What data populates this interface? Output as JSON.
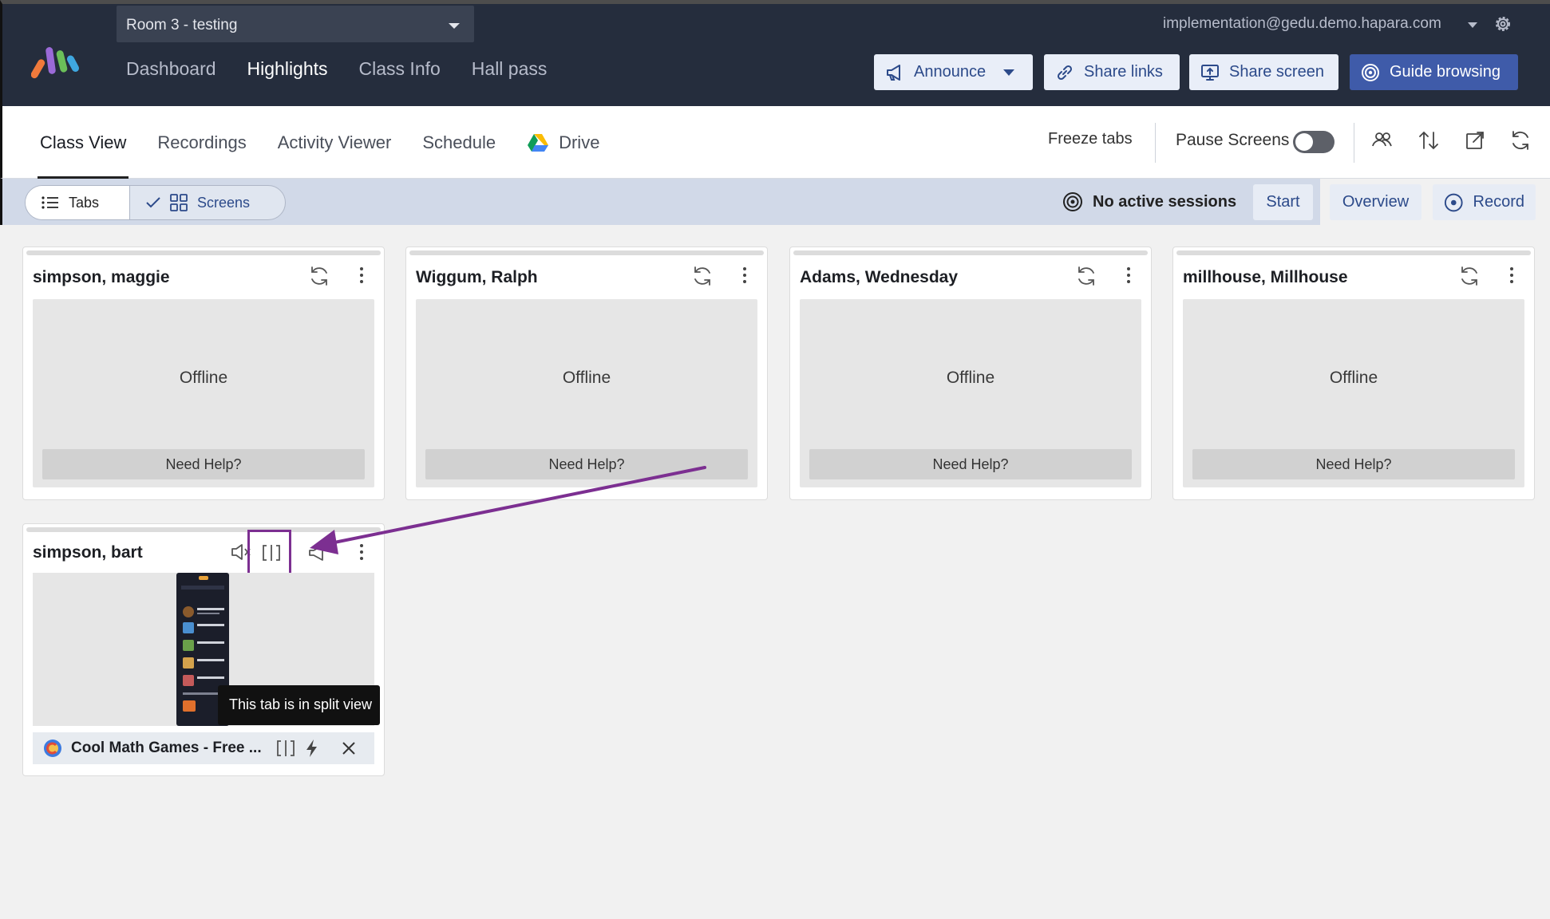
{
  "header": {
    "room_select": "Room 3 - testing",
    "nav": [
      "Dashboard",
      "Highlights",
      "Class Info",
      "Hall pass"
    ],
    "active_nav": "Highlights",
    "user_email": "implementation@gedu.demo.hapara.com",
    "buttons": {
      "announce": "Announce",
      "share_links": "Share links",
      "share_screen": "Share screen",
      "guide_browsing": "Guide browsing"
    }
  },
  "subnav": {
    "tabs": [
      "Class View",
      "Recordings",
      "Activity Viewer",
      "Schedule",
      "Drive"
    ],
    "active_tab": "Class View",
    "freeze_tabs": "Freeze tabs",
    "pause_screens": "Pause Screens",
    "pause_screens_on": false
  },
  "toolbar": {
    "view_tabs": "Tabs",
    "view_screens": "Screens",
    "sessions": "No active sessions",
    "start": "Start",
    "overview": "Overview",
    "record": "Record"
  },
  "students": [
    {
      "name": "simpson, maggie",
      "status": "Offline",
      "help": "Need Help?"
    },
    {
      "name": "Wiggum, Ralph",
      "status": "Offline",
      "help": "Need Help?"
    },
    {
      "name": "Adams, Wednesday",
      "status": "Offline",
      "help": "Need Help?"
    },
    {
      "name": "millhouse, Millhouse",
      "status": "Offline",
      "help": "Need Help?"
    }
  ],
  "active_student": {
    "name": "simpson, bart",
    "tooltip": "This tab is in split view",
    "tab_title": "Cool Math Games - Free ..."
  },
  "colors": {
    "header_bg": "#252d3d",
    "accent": "#3f5ba9",
    "annotation": "#7c2f91"
  }
}
